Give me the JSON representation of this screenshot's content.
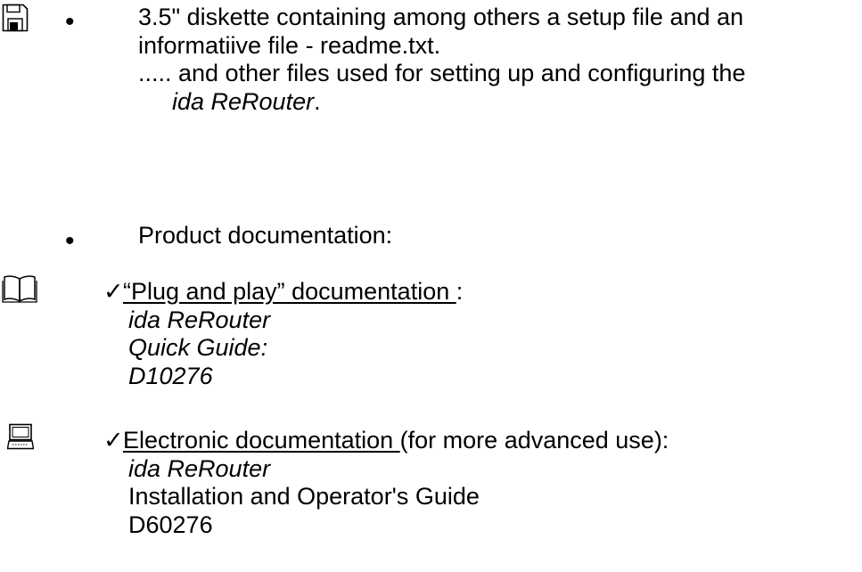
{
  "icons": {
    "diskette": "floppy-disk-icon",
    "book": "open-book-icon",
    "computer": "computer-icon"
  },
  "bullet_glyph": "•",
  "check_glyph": "✓",
  "diskette_item": {
    "line1": "3.5\" diskette containing among others a setup file and an",
    "line2": "informatiive file - readme.txt.",
    "line3": "..... and other files used for setting up and configuring the",
    "line4_product": "ida ReRouter",
    "line4_suffix": "."
  },
  "documentation_item": {
    "label": "Product documentation:"
  },
  "plug_and_play": {
    "title": "“Plug and play” documentation ",
    "colon": ":",
    "product": "ida ReRouter",
    "doc_name": "Quick Guide:",
    "doc_code": "D10276"
  },
  "electronic": {
    "title": "Electronic documentation ",
    "suffix": " (for more advanced use):",
    "product": "ida ReRouter",
    "doc_name": "Installation and Operator's Guide",
    "doc_code": "D60276"
  }
}
